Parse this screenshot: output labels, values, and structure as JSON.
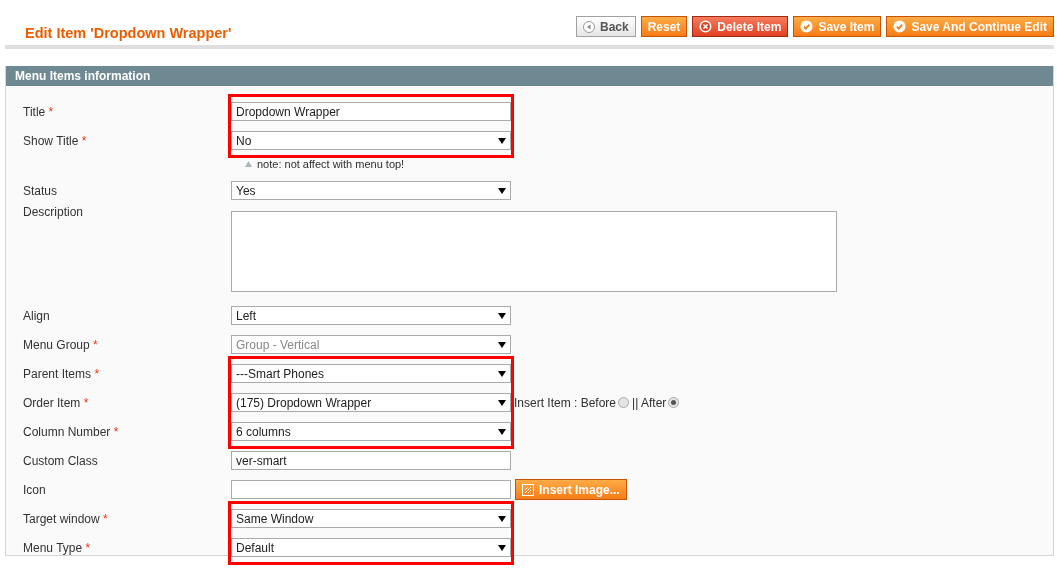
{
  "page_title": "Edit Item 'Dropdown Wrapper'",
  "buttons": [
    {
      "label": "Back",
      "kind": "back"
    },
    {
      "label": "Reset",
      "kind": "plain"
    },
    {
      "label": "Delete Item",
      "kind": "delete"
    },
    {
      "label": "Save Item",
      "kind": "save"
    },
    {
      "label": "Save And Continue Edit",
      "kind": "save"
    }
  ],
  "panel": {
    "title": "Menu Items information",
    "groups": [
      {
        "highlighted": true,
        "fields": [
          {
            "label": "Title",
            "mark": "*",
            "kind": "text",
            "value": "Dropdown Wrapper"
          },
          {
            "label": "Show Title",
            "mark": "*",
            "kind": "select",
            "value": "No"
          }
        ],
        "note": "note: not affect with menu top!"
      },
      {
        "highlighted": false,
        "fields": [
          {
            "label": "Status",
            "kind": "select",
            "value": "Yes"
          },
          {
            "label": "Description",
            "kind": "textarea"
          },
          {
            "label": "Align",
            "kind": "select",
            "value": "Left"
          },
          {
            "label": "Menu Group",
            "mark": "*",
            "kind": "select",
            "value": "Group - Vertical",
            "disabled": true
          }
        ]
      },
      {
        "highlighted": true,
        "fields": [
          {
            "label": "Parent Items",
            "mark": "*",
            "kind": "select",
            "value": "---Smart Phones"
          },
          {
            "label": "Order Item",
            "mark": "*",
            "kind": "select",
            "value": "(175) Dropdown Wrapper",
            "options": [
              {
                "label": "Insert Item : Before",
                "selected": false
              },
              {
                "label": "|| After",
                "selected": true
              }
            ]
          },
          {
            "label": "Column Number",
            "mark": "*",
            "kind": "select",
            "value": "6 columns"
          }
        ]
      },
      {
        "highlighted": false,
        "fields": [
          {
            "label": "Custom Class",
            "kind": "text",
            "value": "ver-smart"
          },
          {
            "label": "Icon",
            "kind": "image",
            "button": "Insert Image..."
          }
        ]
      },
      {
        "highlighted": true,
        "fields": [
          {
            "label": "Target window",
            "mark": "*",
            "kind": "select",
            "value": "Same Window"
          },
          {
            "label": "Menu Type",
            "mark": "*",
            "kind": "select",
            "value": "Default"
          }
        ]
      }
    ]
  }
}
